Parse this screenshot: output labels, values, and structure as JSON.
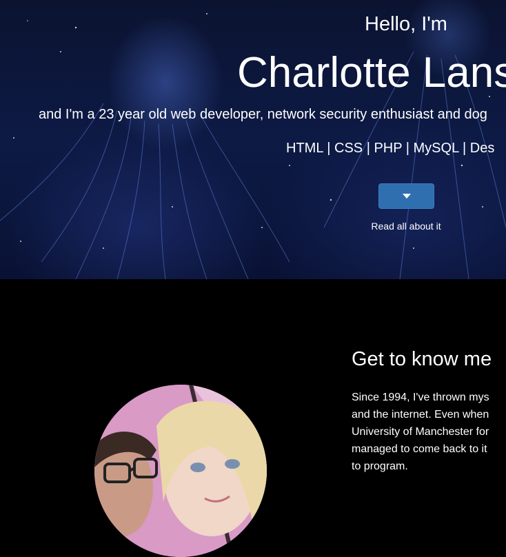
{
  "hero": {
    "greeting": "Hello, I'm",
    "name": "Charlotte Lans",
    "tagline": "and I'm a 23 year old web developer, network security enthusiast and dog",
    "skills": "HTML | CSS | PHP | MySQL | Des",
    "read_button_icon": "chevron-down-icon",
    "read_label": "Read all about it"
  },
  "about": {
    "title": "Get to know me",
    "lines": [
      "Since 1994, I've thrown mys",
      "and the internet. Even when",
      "University of Manchester for",
      "managed to come back to it",
      "to program."
    ]
  },
  "colors": {
    "button": "#2f6fb0",
    "hero_background": "#0d1a45"
  }
}
